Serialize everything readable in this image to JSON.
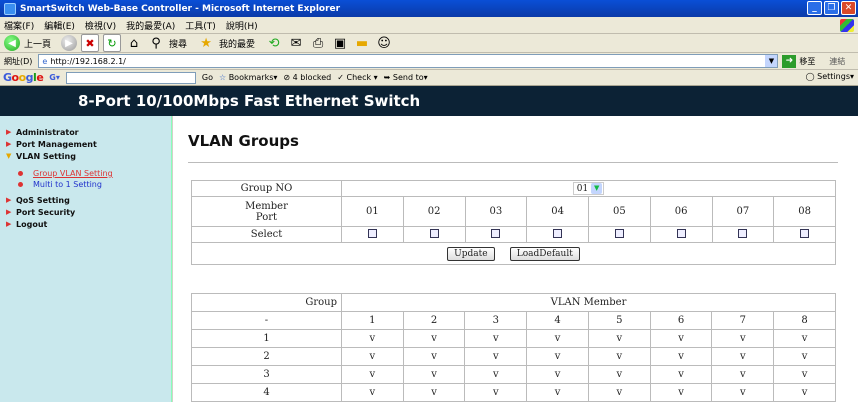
{
  "window": {
    "title": "SmartSwitch Web-Base Controller - Microsoft Internet Explorer"
  },
  "menu": [
    "檔案(F)",
    "編輯(E)",
    "檢視(V)",
    "我的最愛(A)",
    "工具(T)",
    "說明(H)"
  ],
  "toolbar": {
    "back": "上一頁",
    "search": "搜尋",
    "favorites": "我的最愛"
  },
  "address": {
    "label": "網址(D)",
    "url": "http://192.168.2.1/",
    "go": "移至",
    "links": "連結"
  },
  "google": {
    "bookmarks": "Bookmarks▾",
    "blocked": "4 blocked",
    "check": "Check ▾",
    "send": "Send to▾",
    "settings": "Settings▾",
    "go": "Go"
  },
  "header": {
    "title": "8-Port 10/100Mbps Fast Ethernet Switch"
  },
  "sidebar": {
    "items": [
      {
        "label": "Administrator"
      },
      {
        "label": "Port Management"
      },
      {
        "label": "VLAN Setting"
      }
    ],
    "sub": [
      {
        "label": "Group VLAN Setting"
      },
      {
        "label": "Multi to 1 Setting"
      }
    ],
    "items2": [
      {
        "label": "QoS Setting"
      },
      {
        "label": "Port Security"
      },
      {
        "label": "Logout"
      }
    ]
  },
  "main": {
    "title": "VLAN Groups",
    "group_no_label": "Group NO",
    "group_no_value": "01",
    "member_port_label": "Member\nPort",
    "ports": [
      "01",
      "02",
      "03",
      "04",
      "05",
      "06",
      "07",
      "08"
    ],
    "select_label": "Select",
    "update": "Update",
    "load_default": "LoadDefault",
    "t2": {
      "group_label": "Group",
      "vlan_member_label": "VLAN Member",
      "header_dash": "-",
      "cols": [
        "1",
        "2",
        "3",
        "4",
        "5",
        "6",
        "7",
        "8"
      ],
      "rows": [
        {
          "g": "1",
          "v": [
            "v",
            "v",
            "v",
            "v",
            "v",
            "v",
            "v",
            "v"
          ]
        },
        {
          "g": "2",
          "v": [
            "v",
            "v",
            "v",
            "v",
            "v",
            "v",
            "v",
            "v"
          ]
        },
        {
          "g": "3",
          "v": [
            "v",
            "v",
            "v",
            "v",
            "v",
            "v",
            "v",
            "v"
          ]
        },
        {
          "g": "4",
          "v": [
            "v",
            "v",
            "v",
            "v",
            "v",
            "v",
            "v",
            "v"
          ]
        }
      ]
    }
  }
}
